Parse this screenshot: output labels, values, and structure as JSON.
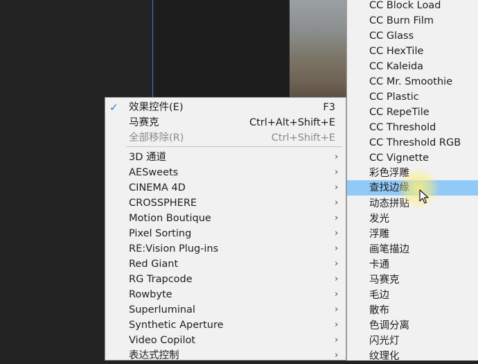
{
  "context_menu": {
    "items": [
      {
        "label": "效果控件(E)",
        "shortcut": "F3",
        "checked": true,
        "disabled": false
      },
      {
        "label": "马赛克",
        "shortcut": "Ctrl+Alt+Shift+E",
        "checked": false,
        "disabled": false
      },
      {
        "label": "全部移除(R)",
        "shortcut": "Ctrl+Shift+E",
        "checked": false,
        "disabled": true
      }
    ],
    "categories": [
      {
        "label": "3D 通道"
      },
      {
        "label": "AESweets"
      },
      {
        "label": "CINEMA 4D"
      },
      {
        "label": "CROSSPHERE"
      },
      {
        "label": "Motion Boutique"
      },
      {
        "label": "Pixel Sorting"
      },
      {
        "label": "RE:Vision Plug-ins"
      },
      {
        "label": "Red Giant"
      },
      {
        "label": "RG Trapcode"
      },
      {
        "label": "Rowbyte"
      },
      {
        "label": "Superluminal"
      },
      {
        "label": "Synthetic Aperture"
      },
      {
        "label": "Video Copilot"
      },
      {
        "label": "表达式控制"
      }
    ],
    "submenu_arrow": "›",
    "check_icon": "✓"
  },
  "submenu": {
    "highlighted_index": 12,
    "items": [
      "CC Block Load",
      "CC Burn Film",
      "CC Glass",
      "CC HexTile",
      "CC Kaleida",
      "CC Mr. Smoothie",
      "CC Plastic",
      "CC RepeTile",
      "CC Threshold",
      "CC Threshold RGB",
      "CC Vignette",
      "彩色浮雕",
      "查找边缘",
      "动态拼贴",
      "发光",
      "浮雕",
      "画笔描边",
      "卡通",
      "马赛克",
      "毛边",
      "散布",
      "色调分离",
      "闪光灯",
      "纹理化"
    ]
  },
  "colors": {
    "highlight": "#91c9f7",
    "menu_bg": "#f1f1f1",
    "check": "#2a72c8"
  }
}
